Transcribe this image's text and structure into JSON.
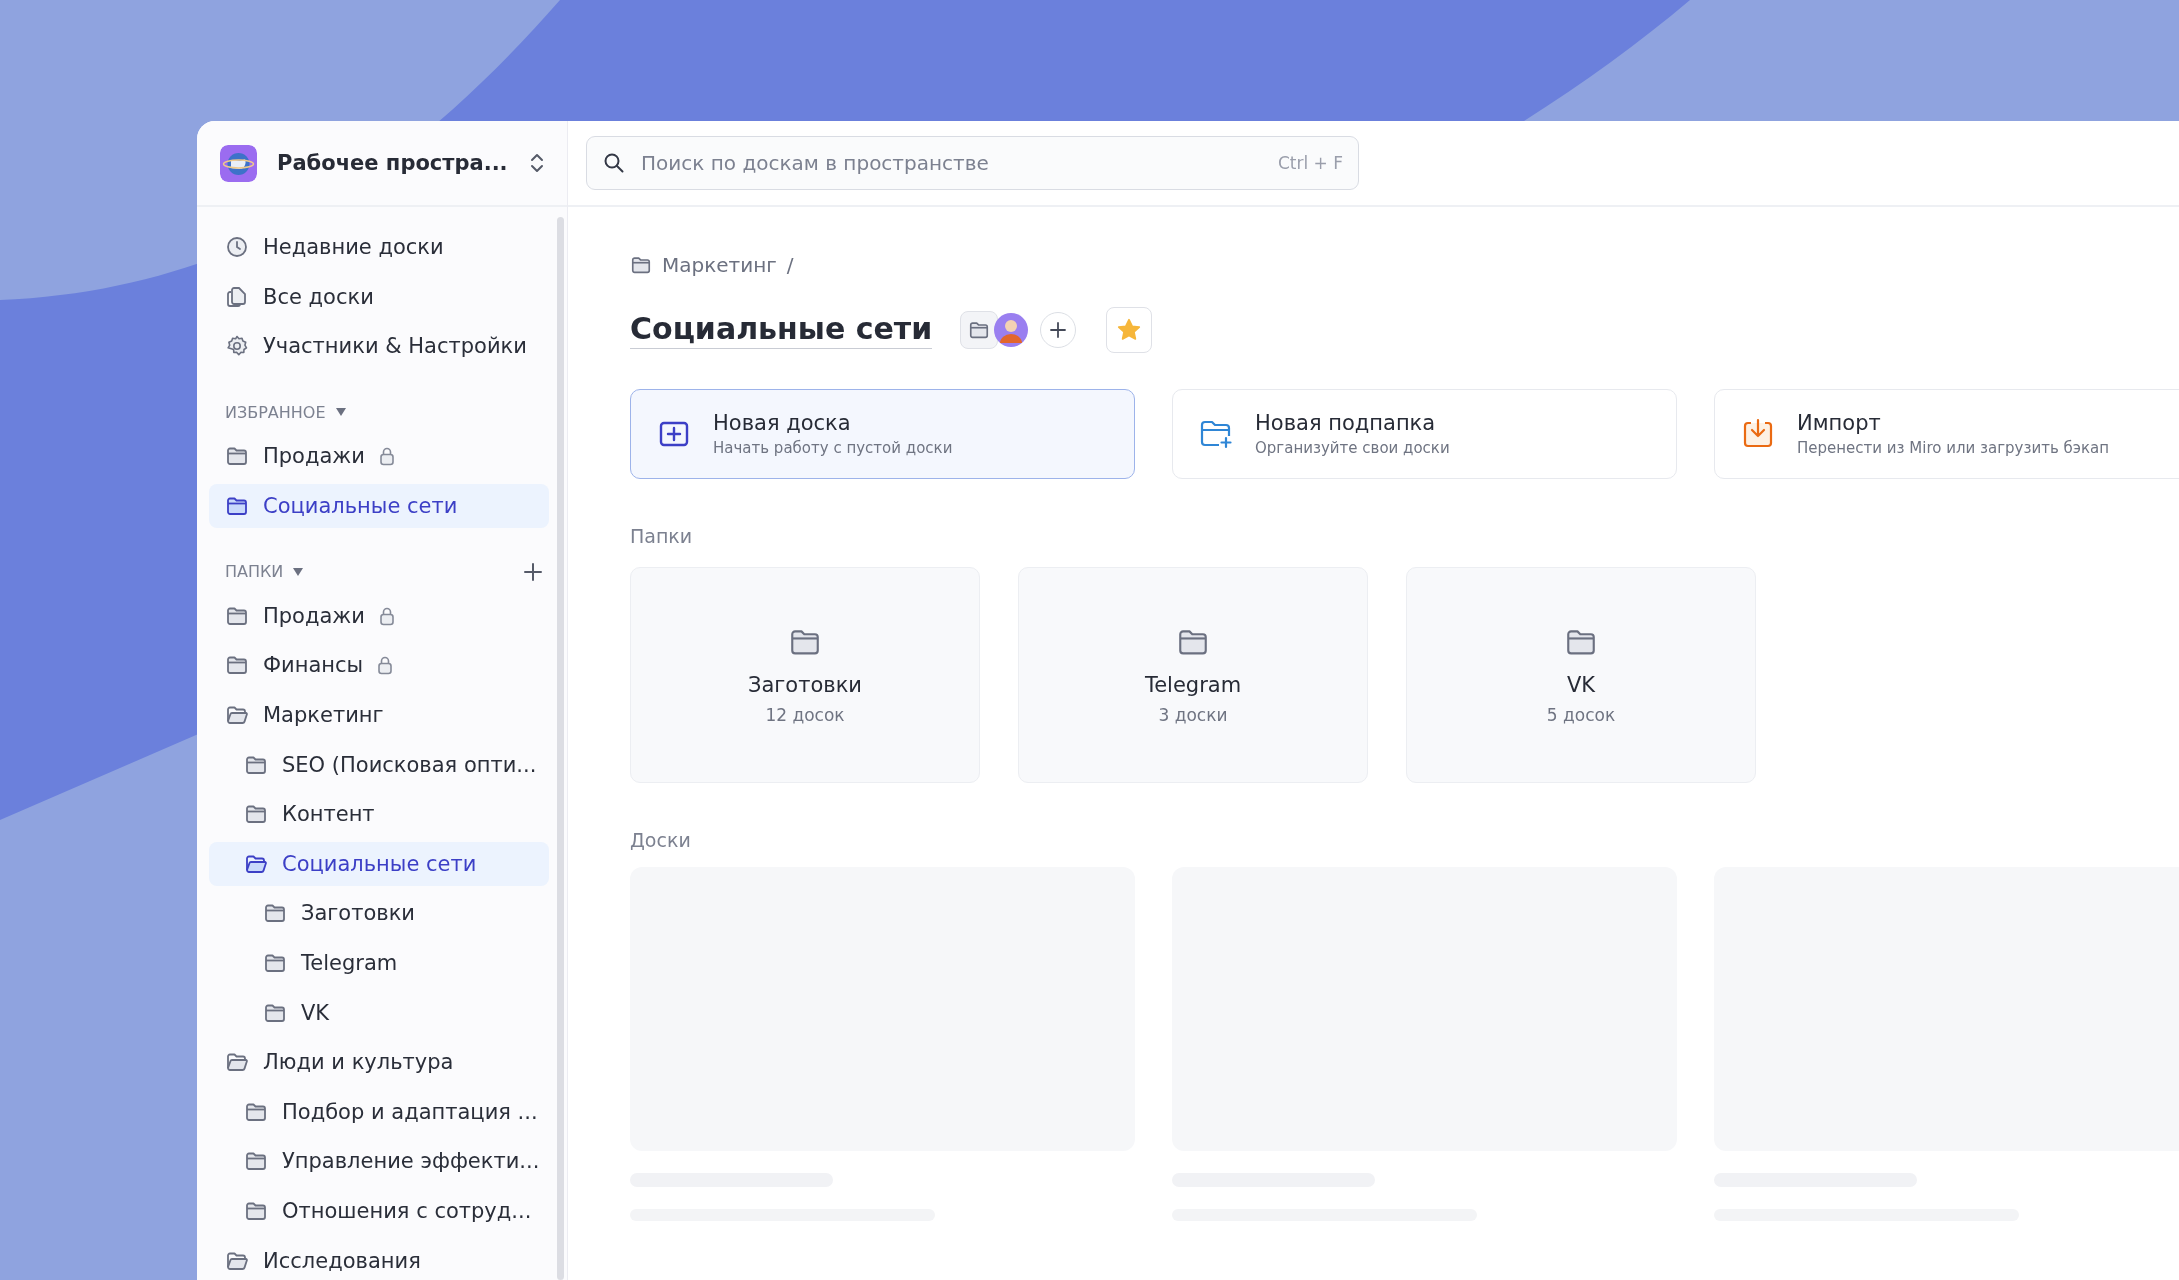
{
  "workspace": {
    "name": "Рабочее простра..."
  },
  "search": {
    "placeholder": "Поиск по доскам в пространстве",
    "shortcut": "Ctrl + F"
  },
  "nav": [
    {
      "kind": "clock",
      "label": "Недавние доски"
    },
    {
      "kind": "boards",
      "label": "Все доски"
    },
    {
      "kind": "gear",
      "label": "Участники & Настройки"
    }
  ],
  "favorites": {
    "title": "ИЗБРАННОЕ",
    "items": [
      {
        "label": "Продажи",
        "locked": true,
        "selected": false
      },
      {
        "label": "Социальные сети",
        "locked": false,
        "selected": true
      }
    ]
  },
  "folders": {
    "title": "ПАПКИ",
    "items": [
      {
        "label": "Продажи",
        "locked": true,
        "expanded": false,
        "selected": false
      },
      {
        "label": "Финансы",
        "locked": true,
        "expanded": false,
        "selected": false
      },
      {
        "label": "Маркетинг",
        "locked": false,
        "expanded": true,
        "selected": false,
        "children": [
          {
            "label": "SEO (Поисковая опти...",
            "expanded": false,
            "selected": false
          },
          {
            "label": "Контент",
            "locked": false,
            "expanded": false,
            "selected": false
          },
          {
            "label": "Социальные сети",
            "locked": false,
            "expanded": true,
            "selected": true,
            "children": [
              {
                "label": "Заготовки",
                "locked": false,
                "expanded": false,
                "selected": false
              },
              {
                "label": "Telegram",
                "locked": false,
                "expanded": false,
                "selected": false
              },
              {
                "label": "VK",
                "locked": false,
                "expanded": false,
                "selected": false
              }
            ]
          }
        ]
      },
      {
        "label": "Люди и культура",
        "locked": false,
        "expanded": true,
        "selected": false,
        "children": [
          {
            "label": "Подбор и адаптация ...",
            "expanded": false,
            "selected": false
          },
          {
            "label": "Управление эффекти...",
            "expanded": false,
            "selected": false
          },
          {
            "label": "Отношения с сотруд...",
            "locked": false,
            "expanded": false,
            "selected": false
          }
        ]
      },
      {
        "label": "Исследования",
        "locked": false,
        "expanded": true,
        "selected": false
      }
    ]
  },
  "breadcrumb": {
    "items": [
      "Маркетинг"
    ],
    "separator": "/"
  },
  "page": {
    "title": "Социальные сети",
    "favorite": true
  },
  "actions": [
    {
      "kind": "new_board",
      "title": "Новая доска",
      "subtitle": "Начать работу с пустой доски",
      "selected": true
    },
    {
      "kind": "new_folder",
      "title": "Новая подпапка",
      "subtitle": "Организуйте свои доски",
      "selected": false
    },
    {
      "kind": "import",
      "title": "Импорт",
      "subtitle": "Перенести из Miro или загрузить бэкап",
      "selected": false
    }
  ],
  "folder_section": {
    "title": "Папки",
    "items": [
      {
        "name": "Заготовки",
        "count": "12 досок"
      },
      {
        "name": "Telegram",
        "count": "3 доски"
      },
      {
        "name": "VK",
        "count": "5 досок"
      }
    ]
  },
  "board_section": {
    "title": "Доски",
    "items": [
      {
        "kind": "skeleton"
      },
      {
        "kind": "skeleton"
      },
      {
        "kind": "skeleton"
      }
    ]
  }
}
